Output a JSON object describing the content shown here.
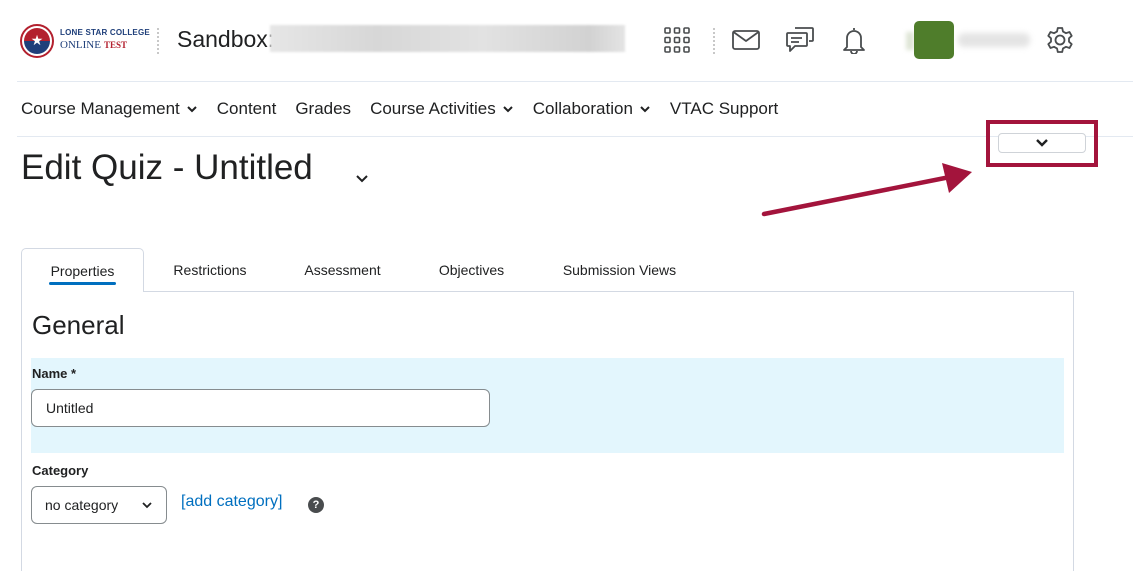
{
  "header": {
    "logo": {
      "line1": "LONE STAR COLLEGE",
      "line2": "ONLINE",
      "line3": "TEST"
    },
    "org_title": "Sandbox:",
    "icons": [
      "apps-grid-icon",
      "mail-icon",
      "chat-icon",
      "bell-icon",
      "gear-icon"
    ]
  },
  "nav": {
    "items": [
      {
        "label": "Course Management",
        "has_menu": true
      },
      {
        "label": "Content",
        "has_menu": false
      },
      {
        "label": "Grades",
        "has_menu": false
      },
      {
        "label": "Course Activities",
        "has_menu": true
      },
      {
        "label": "Collaboration",
        "has_menu": true
      },
      {
        "label": "VTAC Support",
        "has_menu": false
      }
    ]
  },
  "page": {
    "title": "Edit Quiz - Untitled"
  },
  "tabs": [
    {
      "label": "Properties",
      "active": true
    },
    {
      "label": "Restrictions",
      "active": false
    },
    {
      "label": "Assessment",
      "active": false
    },
    {
      "label": "Objectives",
      "active": false
    },
    {
      "label": "Submission Views",
      "active": false
    }
  ],
  "form": {
    "section_title": "General",
    "name_label": "Name *",
    "name_value": "Untitled",
    "category_label": "Category",
    "category_value": "no category",
    "add_category_link": "[add category]",
    "help_glyph": "?"
  },
  "colors": {
    "accent": "#006fbf",
    "annotation": "#a3143c",
    "highlight_band": "#e3f6fd"
  }
}
